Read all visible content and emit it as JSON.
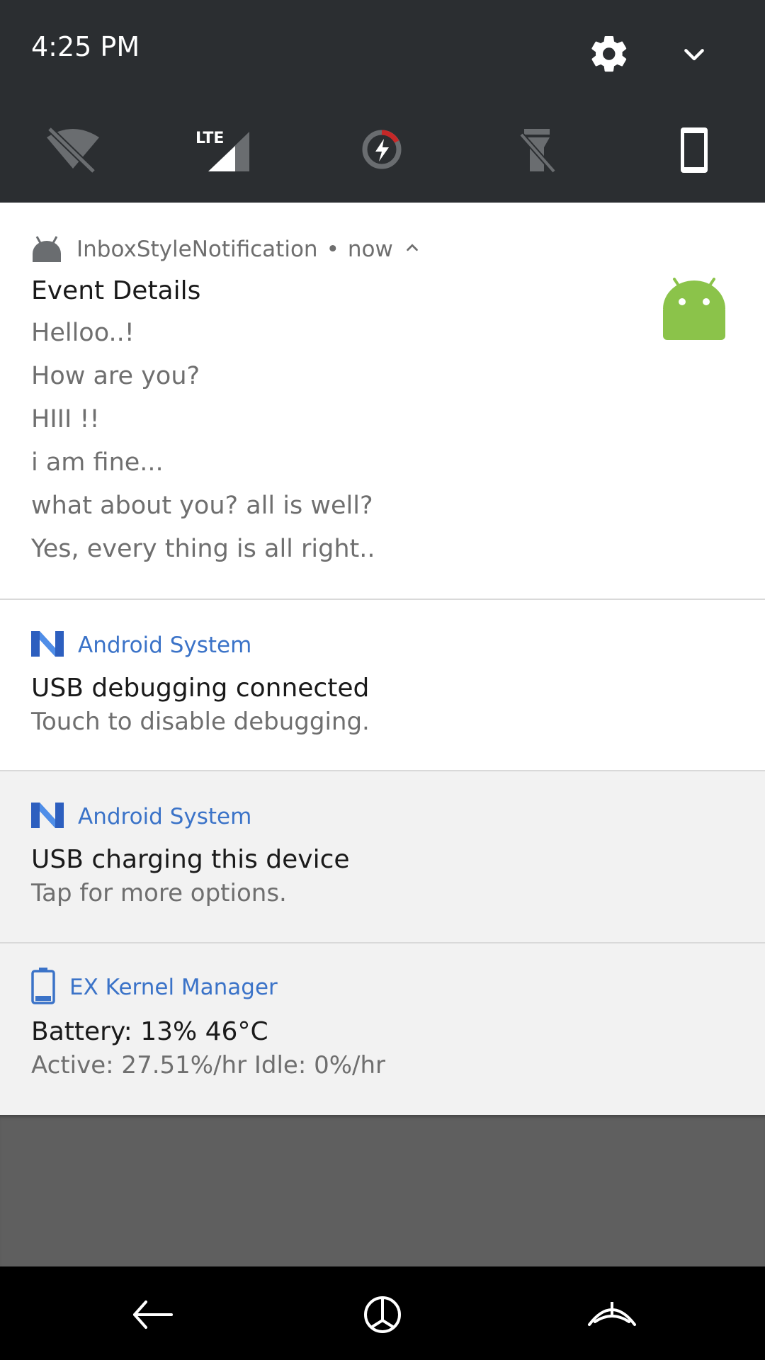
{
  "status": {
    "time": "4:25 PM"
  },
  "quick_settings": {
    "tiles": [
      {
        "name": "wifi-off-icon"
      },
      {
        "name": "lte-signal-icon",
        "label": "LTE"
      },
      {
        "name": "battery-saver-icon"
      },
      {
        "name": "flashlight-icon"
      },
      {
        "name": "phone-icon"
      }
    ]
  },
  "notifications": [
    {
      "app": "InboxStyleNotification",
      "time": "now",
      "title": "Event Details",
      "lines": [
        "Helloo..!",
        "How are you?",
        "HIII !!",
        "i am fine...",
        "what about you? all is well?",
        "Yes, every thing is all right.."
      ]
    },
    {
      "app": "Android System",
      "title": "USB debugging connected",
      "text": "Touch to disable debugging."
    },
    {
      "app": "Android System",
      "title": "USB charging this device",
      "text": "Tap for more options."
    },
    {
      "app": "EX Kernel Manager",
      "title": "Battery: 13%  46°C",
      "text": "Active:  27.51%/hr   Idle:  0%/hr"
    }
  ],
  "colors": {
    "header_bg": "#2b2e31",
    "accent_blue": "#3b73c8",
    "android_green": "#8bc34a",
    "scrim": "#5f5f5f"
  }
}
